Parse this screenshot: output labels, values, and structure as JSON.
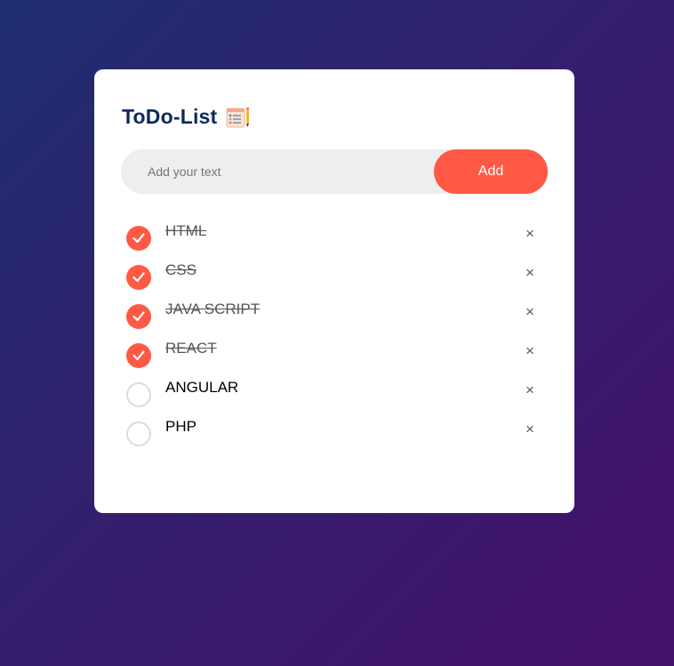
{
  "app": {
    "title": "ToDo-List",
    "title_icon": "notepad-icon"
  },
  "input": {
    "placeholder": "Add your text",
    "value": ""
  },
  "add_button": {
    "label": "Add"
  },
  "colors": {
    "accent": "#ff5945",
    "title": "#0d2a5c",
    "input_bg": "#edeef0"
  },
  "items": [
    {
      "label": "HTML",
      "done": true,
      "remove_glyph": "×"
    },
    {
      "label": "CSS",
      "done": true,
      "remove_glyph": "×"
    },
    {
      "label": "JAVA SCRIPT",
      "done": true,
      "remove_glyph": "×"
    },
    {
      "label": "REACT",
      "done": true,
      "remove_glyph": "×"
    },
    {
      "label": "ANGULAR",
      "done": false,
      "remove_glyph": "×"
    },
    {
      "label": "PHP",
      "done": false,
      "remove_glyph": "×"
    }
  ]
}
